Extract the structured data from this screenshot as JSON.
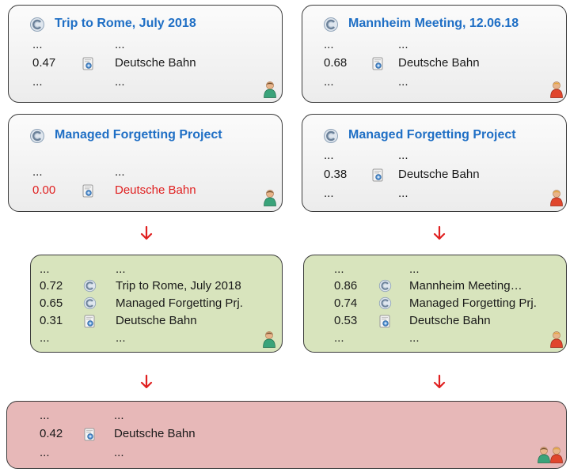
{
  "colors": {
    "title_blue": "#1f6fc5",
    "arrow_red": "#e02020",
    "green_fill": "#d8e4bd",
    "red_fill": "#e7b8b8",
    "gray_fill": "#f0f0f0"
  },
  "cards": {
    "c1": {
      "title": "Trip to Rome, July 2018",
      "rows": [
        {
          "num": "...",
          "label": "..."
        },
        {
          "num": "0.47",
          "label": "Deutsche Bahn"
        },
        {
          "num": "...",
          "label": "..."
        }
      ],
      "user_color": "green"
    },
    "c2": {
      "title": "Mannheim Meeting, 12.06.18",
      "rows": [
        {
          "num": "...",
          "label": "..."
        },
        {
          "num": "0.68",
          "label": "Deutsche Bahn"
        },
        {
          "num": "...",
          "label": "..."
        }
      ],
      "user_color": "red"
    },
    "c3": {
      "title": "Managed Forgetting Project",
      "rows": [
        {
          "num": "...",
          "label": "..."
        },
        {
          "num": "0.00",
          "label": "Deutsche Bahn"
        }
      ],
      "user_color": "green"
    },
    "c4": {
      "title": "Managed Forgetting Project",
      "rows": [
        {
          "num": "...",
          "label": "..."
        },
        {
          "num": "0.38",
          "label": "Deutsche Bahn"
        },
        {
          "num": "...",
          "label": "..."
        }
      ],
      "user_color": "red"
    },
    "c5": {
      "rows": [
        {
          "num": "...",
          "label": "..."
        },
        {
          "num": "0.72",
          "label": "Trip to Rome, July 2018"
        },
        {
          "num": "0.65",
          "label": "Managed Forgetting Prj."
        },
        {
          "num": "0.31",
          "label": "Deutsche Bahn"
        },
        {
          "num": "...",
          "label": "..."
        }
      ],
      "user_color": "green"
    },
    "c6": {
      "rows": [
        {
          "num": "...",
          "label": "..."
        },
        {
          "num": "0.86",
          "label": "Mannheim Meeting…"
        },
        {
          "num": "0.74",
          "label": "Managed Forgetting Prj."
        },
        {
          "num": "0.53",
          "label": "Deutsche Bahn"
        },
        {
          "num": "...",
          "label": "..."
        }
      ],
      "user_color": "red"
    },
    "c7": {
      "rows": [
        {
          "num": "...",
          "label": "..."
        },
        {
          "num": "0.42",
          "label": "Deutsche Bahn"
        },
        {
          "num": "...",
          "label": "..."
        }
      ],
      "user_colors": [
        "green",
        "red"
      ]
    }
  }
}
